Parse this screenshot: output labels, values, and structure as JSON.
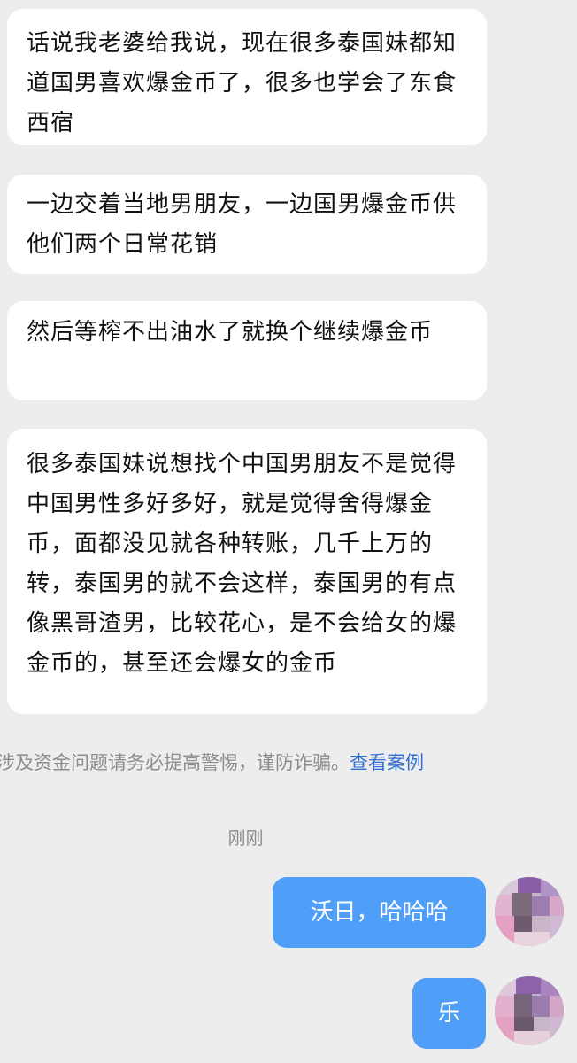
{
  "incoming_messages": [
    {
      "text": "话说我老婆给我说，现在很多泰国妹都知道国男喜欢爆金币了，很多也学会了东食西宿"
    },
    {
      "text": "一边交着当地男朋友，一边国男爆金币供他们两个日常花销"
    },
    {
      "text": "然后等榨不出油水了就换个继续爆金币"
    },
    {
      "text": "很多泰国妹说想找个中国男朋友不是觉得中国男性多好多好，就是觉得舍得爆金币，面都没见就各种转账，几千上万的转，泰国男的就不会这样，泰国男的有点像黑哥渣男，比较花心，是不会给女的爆金币的，甚至还会爆女的金币"
    }
  ],
  "notice": {
    "text": "涉及资金问题请务必提高警惕，谨防诈骗。",
    "link": "查看案例"
  },
  "timestamp": "刚刚",
  "outgoing_messages": [
    {
      "text": "沃日，哈哈哈"
    },
    {
      "text": "乐"
    }
  ],
  "colors": {
    "background": "#ededed",
    "incoming_bubble": "#ffffff",
    "outgoing_bubble": "#4f9ef7",
    "link": "#2e6fd6"
  }
}
